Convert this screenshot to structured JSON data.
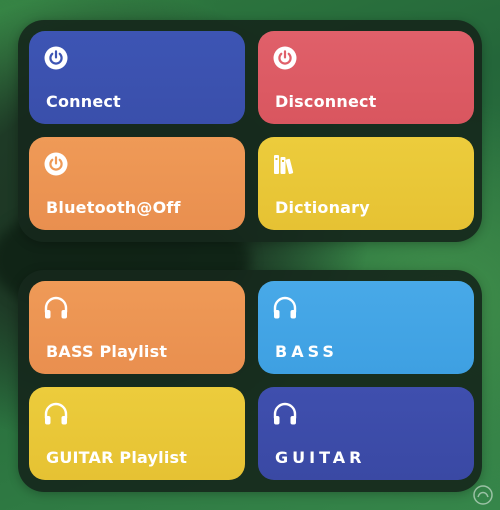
{
  "colors": {
    "connect": "#3d55b4",
    "disconnect": "#e0606a",
    "bluetooth_off": "#ef9a57",
    "dictionary": "#eccc3c",
    "bass_playlist": "#ef9a57",
    "bass": "#48a9e8",
    "guitar_playlist": "#eccc3c",
    "guitar": "#3f4fae",
    "widget_background": "#16281c"
  },
  "widgets": [
    {
      "tiles": [
        {
          "label": "Connect",
          "icon": "power-icon"
        },
        {
          "label": "Disconnect",
          "icon": "power-icon"
        },
        {
          "label": "Bluetooth@Off",
          "icon": "power-icon"
        },
        {
          "label": "Dictionary",
          "icon": "books-icon"
        }
      ]
    },
    {
      "tiles": [
        {
          "label": "BASS Playlist",
          "icon": "headphones-icon"
        },
        {
          "label": "BASS",
          "icon": "headphones-icon"
        },
        {
          "label": "GUITAR Playlist",
          "icon": "headphones-icon"
        },
        {
          "label": "GUITAR",
          "icon": "headphones-icon"
        }
      ]
    }
  ]
}
